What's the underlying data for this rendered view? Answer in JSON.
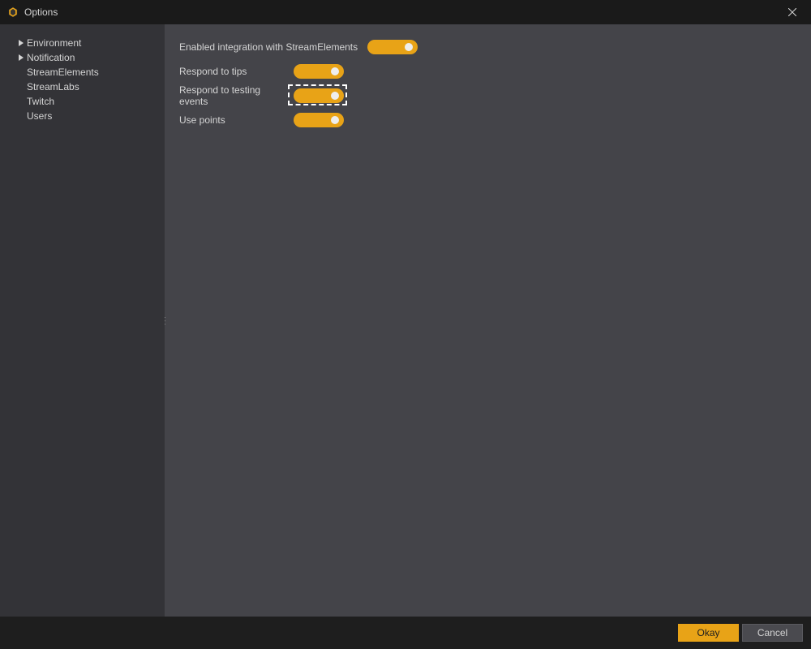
{
  "window": {
    "title": "Options"
  },
  "sidebar": {
    "items": [
      {
        "label": "Environment",
        "expandable": true
      },
      {
        "label": "Notification",
        "expandable": true
      },
      {
        "label": "StreamElements",
        "expandable": false,
        "selected": true
      },
      {
        "label": "StreamLabs",
        "expandable": false
      },
      {
        "label": "Twitch",
        "expandable": false
      },
      {
        "label": "Users",
        "expandable": false
      }
    ]
  },
  "settings": [
    {
      "label": "Enabled integration with StreamElements",
      "value": true
    },
    {
      "label": "Respond to tips",
      "value": true
    },
    {
      "label": "Respond to testing events",
      "value": true,
      "highlighted": true
    },
    {
      "label": "Use points",
      "value": true
    }
  ],
  "footer": {
    "okay_label": "Okay",
    "cancel_label": "Cancel"
  },
  "colors": {
    "accent": "#e8a317"
  }
}
